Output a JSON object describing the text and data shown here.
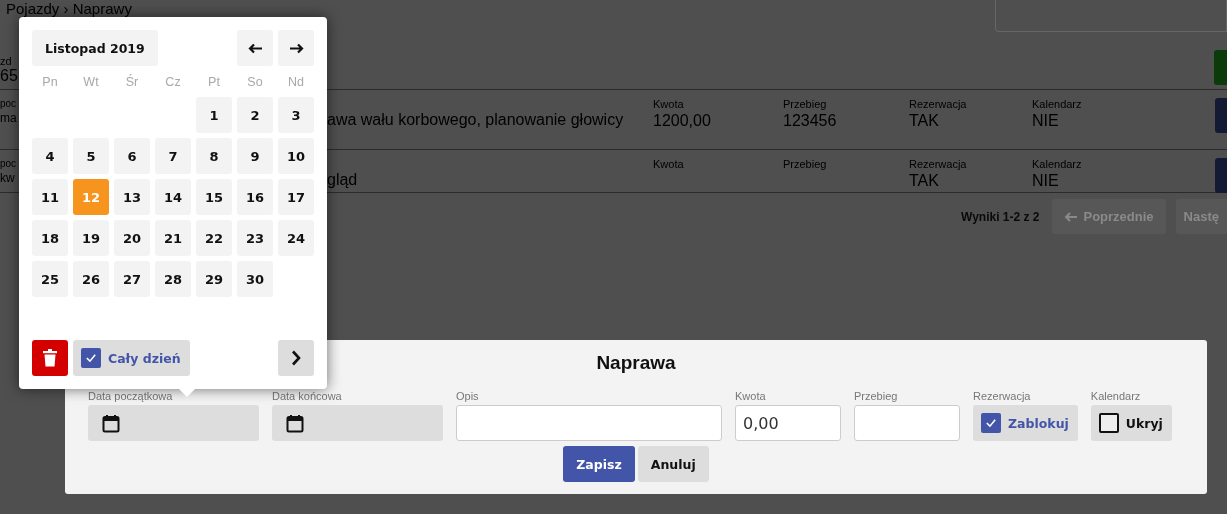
{
  "page": {
    "breadcrumb": "Pojazdy › Naprawy",
    "filter": {
      "label": "zd",
      "value": "65"
    },
    "rows": [
      {
        "cells": [
          {
            "label": "poc",
            "value": "ma"
          },
          {
            "value": "awa wału korbowego, planowanie głowicy"
          },
          {
            "label": "Kwota",
            "value": "1200,00"
          },
          {
            "label": "Przebieg",
            "value": "123456"
          },
          {
            "label": "Rezerwacja",
            "value": "TAK"
          },
          {
            "label": "Kalendarz",
            "value": "NIE"
          }
        ]
      },
      {
        "cells": [
          {
            "label": "poc",
            "value": "kw"
          },
          {
            "value": "gląd"
          },
          {
            "label": "Kwota"
          },
          {
            "label": "Przebieg"
          },
          {
            "label": "Rezerwacja",
            "value": "TAK"
          },
          {
            "label": "Kalendarz",
            "value": "NIE"
          }
        ]
      }
    ],
    "pagination": {
      "summary": "Wyniki 1-2 z 2",
      "buttons": [
        {
          "label": "Poprzednie",
          "kind": "prev",
          "disabled": true
        },
        {
          "label": "Nastę",
          "kind": "next",
          "disabled": true
        }
      ]
    }
  },
  "calendar": {
    "month_label": "Listopad 2019",
    "weekdays": [
      "Pn",
      "Wt",
      "Śr",
      "Cz",
      "Pt",
      "So",
      "Nd"
    ],
    "weeks": [
      [
        {
          "kind": "empty"
        },
        {
          "kind": "empty"
        },
        {
          "kind": "empty"
        },
        {
          "kind": "empty"
        },
        {
          "day": "1",
          "selected": false
        },
        {
          "day": "2",
          "selected": false
        },
        {
          "day": "3",
          "selected": false
        }
      ],
      [
        {
          "day": "4",
          "selected": false
        },
        {
          "day": "5",
          "selected": false
        },
        {
          "day": "6",
          "selected": false
        },
        {
          "day": "7",
          "selected": false
        },
        {
          "day": "8",
          "selected": false
        },
        {
          "day": "9",
          "selected": false
        },
        {
          "day": "10",
          "selected": false
        }
      ],
      [
        {
          "day": "11",
          "selected": false
        },
        {
          "day": "12",
          "selected": true
        },
        {
          "day": "13",
          "selected": false
        },
        {
          "day": "14",
          "selected": false
        },
        {
          "day": "15",
          "selected": false
        },
        {
          "day": "16",
          "selected": false
        },
        {
          "day": "17",
          "selected": false
        }
      ],
      [
        {
          "day": "18",
          "selected": false
        },
        {
          "day": "19",
          "selected": false
        },
        {
          "day": "20",
          "selected": false
        },
        {
          "day": "21",
          "selected": false
        },
        {
          "day": "22",
          "selected": false
        },
        {
          "day": "23",
          "selected": false
        },
        {
          "day": "24",
          "selected": false
        }
      ],
      [
        {
          "day": "25",
          "selected": false
        },
        {
          "day": "26",
          "selected": false
        },
        {
          "day": "27",
          "selected": false
        },
        {
          "day": "28",
          "selected": false
        },
        {
          "day": "29",
          "selected": false
        },
        {
          "day": "30",
          "selected": false
        },
        {
          "kind": "empty"
        }
      ]
    ],
    "all_day": {
      "label": "Cały dzień",
      "checked": true
    }
  },
  "form": {
    "title": "Naprawa",
    "fields": [
      {
        "kind": "date",
        "label": "Data początkowa"
      },
      {
        "kind": "date",
        "label": "Data końcowa"
      },
      {
        "kind": "wide_text",
        "label": "Opis"
      },
      {
        "kind": "text",
        "label": "Kwota",
        "value": "0,00"
      },
      {
        "kind": "text",
        "label": "Przebieg"
      },
      {
        "kind": "toggle",
        "label": "Rezerwacja",
        "text": "Zablokuj",
        "checked": true
      },
      {
        "kind": "toggle",
        "label": "Kalendarz",
        "text": "Ukryj",
        "checked": false
      }
    ],
    "buttons": [
      {
        "label": "Zapisz",
        "kind": "primary"
      },
      {
        "label": "Anuluj",
        "kind": "secondary"
      }
    ]
  }
}
